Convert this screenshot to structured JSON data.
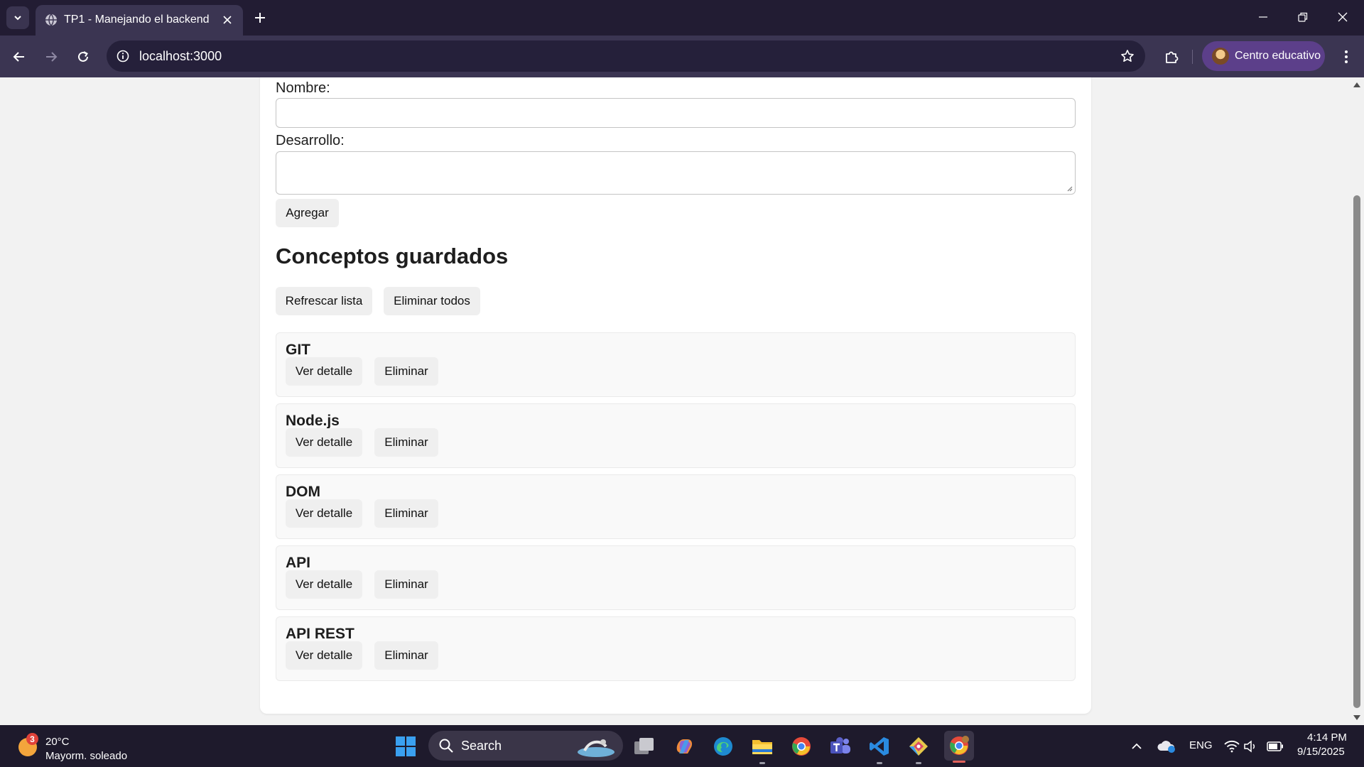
{
  "browser": {
    "tab_title": "TP1 - Manejando el backend",
    "url": "localhost:3000",
    "profile_name": "Centro educativo"
  },
  "form": {
    "name_label": "Nombre:",
    "name_value": "",
    "dev_label": "Desarrollo:",
    "dev_value": "",
    "add_button": "Agregar"
  },
  "saved": {
    "title": "Conceptos guardados",
    "refresh_button": "Refrescar lista",
    "delete_all_button": "Eliminar todos",
    "detail_label": "Ver detalle",
    "delete_label": "Eliminar",
    "items": [
      {
        "name": "GIT"
      },
      {
        "name": "Node.js"
      },
      {
        "name": "DOM"
      },
      {
        "name": "API"
      },
      {
        "name": "API REST"
      }
    ]
  },
  "taskbar": {
    "weather_badge": "3",
    "temperature": "20°C",
    "weather_desc": "Mayorm. soleado",
    "search_label": "Search",
    "language": "ENG",
    "time": "4:14 PM",
    "date": "9/15/2025"
  },
  "colors": {
    "tabbar": "#221c33",
    "toolbar": "#3b3552",
    "profile": "#5c3f8a",
    "button": "#efefef",
    "page_bg": "#f2f2f2"
  }
}
